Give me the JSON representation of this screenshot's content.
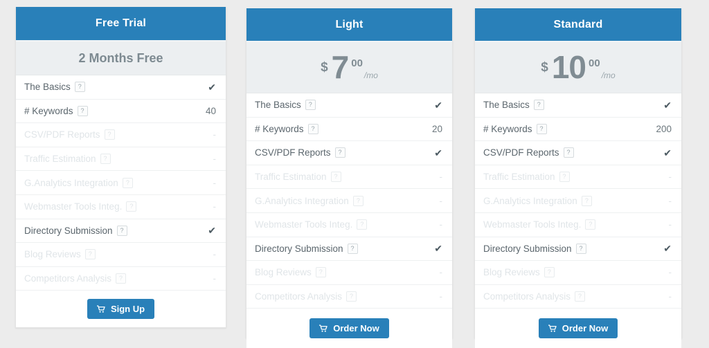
{
  "theme": {
    "accent": "#2980b9",
    "page_background": "#ececec",
    "price_band": "#eceff1",
    "enabled_text": "#5b666d",
    "disabled_text": "#e0e5e8"
  },
  "plans": [
    {
      "id": "free-trial",
      "title": "Free Trial",
      "price_kind": "text",
      "price_text": "2 Months Free",
      "currency": "",
      "amount": "",
      "cents": "",
      "period": "",
      "cta_label": "Sign Up",
      "cta_icon": "shopping-cart-icon",
      "features": [
        {
          "label": "The Basics",
          "help": "?",
          "value": "✔",
          "type": "check",
          "enabled": true
        },
        {
          "label": "# Keywords",
          "help": "?",
          "value": "40",
          "type": "number",
          "enabled": true
        },
        {
          "label": "CSV/PDF Reports",
          "help": "?",
          "value": "-",
          "type": "dash",
          "enabled": false
        },
        {
          "label": "Traffic Estimation",
          "help": "?",
          "value": "-",
          "type": "dash",
          "enabled": false
        },
        {
          "label": "G.Analytics Integration",
          "help": "?",
          "value": "-",
          "type": "dash",
          "enabled": false
        },
        {
          "label": "Webmaster Tools Integ.",
          "help": "?",
          "value": "-",
          "type": "dash",
          "enabled": false
        },
        {
          "label": "Directory Submission",
          "help": "?",
          "value": "✔",
          "type": "check",
          "enabled": true
        },
        {
          "label": "Blog Reviews",
          "help": "?",
          "value": "-",
          "type": "dash",
          "enabled": false
        },
        {
          "label": "Competitors Analysis",
          "help": "?",
          "value": "-",
          "type": "dash",
          "enabled": false
        }
      ]
    },
    {
      "id": "light",
      "title": "Light",
      "price_kind": "figure",
      "price_text": "",
      "currency": "$",
      "amount": "7",
      "cents": "00",
      "period": "/mo",
      "cta_label": "Order Now",
      "cta_icon": "shopping-cart-icon",
      "features": [
        {
          "label": "The Basics",
          "help": "?",
          "value": "✔",
          "type": "check",
          "enabled": true
        },
        {
          "label": "# Keywords",
          "help": "?",
          "value": "20",
          "type": "number",
          "enabled": true
        },
        {
          "label": "CSV/PDF Reports",
          "help": "?",
          "value": "✔",
          "type": "check",
          "enabled": true
        },
        {
          "label": "Traffic Estimation",
          "help": "?",
          "value": "-",
          "type": "dash",
          "enabled": false
        },
        {
          "label": "G.Analytics Integration",
          "help": "?",
          "value": "-",
          "type": "dash",
          "enabled": false
        },
        {
          "label": "Webmaster Tools Integ.",
          "help": "?",
          "value": "-",
          "type": "dash",
          "enabled": false
        },
        {
          "label": "Directory Submission",
          "help": "?",
          "value": "✔",
          "type": "check",
          "enabled": true
        },
        {
          "label": "Blog Reviews",
          "help": "?",
          "value": "-",
          "type": "dash",
          "enabled": false
        },
        {
          "label": "Competitors Analysis",
          "help": "?",
          "value": "-",
          "type": "dash",
          "enabled": false
        }
      ]
    },
    {
      "id": "standard",
      "title": "Standard",
      "price_kind": "figure",
      "price_text": "",
      "currency": "$",
      "amount": "10",
      "cents": "00",
      "period": "/mo",
      "cta_label": "Order Now",
      "cta_icon": "shopping-cart-icon",
      "features": [
        {
          "label": "The Basics",
          "help": "?",
          "value": "✔",
          "type": "check",
          "enabled": true
        },
        {
          "label": "# Keywords",
          "help": "?",
          "value": "200",
          "type": "number",
          "enabled": true
        },
        {
          "label": "CSV/PDF Reports",
          "help": "?",
          "value": "✔",
          "type": "check",
          "enabled": true
        },
        {
          "label": "Traffic Estimation",
          "help": "?",
          "value": "-",
          "type": "dash",
          "enabled": false
        },
        {
          "label": "G.Analytics Integration",
          "help": "?",
          "value": "-",
          "type": "dash",
          "enabled": false
        },
        {
          "label": "Webmaster Tools Integ.",
          "help": "?",
          "value": "-",
          "type": "dash",
          "enabled": false
        },
        {
          "label": "Directory Submission",
          "help": "?",
          "value": "✔",
          "type": "check",
          "enabled": true
        },
        {
          "label": "Blog Reviews",
          "help": "?",
          "value": "-",
          "type": "dash",
          "enabled": false
        },
        {
          "label": "Competitors Analysis",
          "help": "?",
          "value": "-",
          "type": "dash",
          "enabled": false
        }
      ]
    }
  ]
}
